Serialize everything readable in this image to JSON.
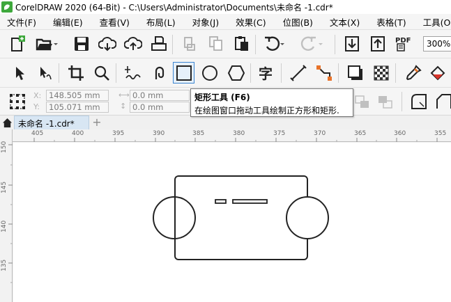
{
  "titlebar": {
    "title": "CorelDRAW 2020 (64-Bit) - C:\\Users\\Administrator\\Documents\\未命名 -1.cdr*"
  },
  "menubar": {
    "items": [
      "文件(F)",
      "编辑(E)",
      "查看(V)",
      "布局(L)",
      "对象(J)",
      "效果(C)",
      "位图(B)",
      "文本(X)",
      "表格(T)",
      "工具(O)"
    ]
  },
  "standard_toolbar": {
    "zoom": "300%",
    "icons": [
      "new-document-icon",
      "open-icon",
      "save-icon",
      "cloud-download-icon",
      "cloud-upload-icon",
      "print-icon",
      "cut-icon",
      "copy-icon",
      "paste-icon",
      "undo-icon",
      "redo-icon",
      "import-icon",
      "export-icon",
      "publish-pdf-icon"
    ]
  },
  "toolbox": {
    "icons": [
      "pick-tool-icon",
      "shape-tool-icon",
      "crop-tool-icon",
      "zoom-tool-icon",
      "freehand-tool-icon",
      "artistic-media-icon",
      "rectangle-tool-icon",
      "ellipse-tool-icon",
      "polygon-tool-icon",
      "text-tool-icon",
      "parallel-dimension-icon",
      "connector-icon",
      "drop-shadow-icon",
      "transparency-icon",
      "eyedropper-icon",
      "interactive-fill-icon"
    ],
    "active": "rectangle-tool-icon"
  },
  "property_bar": {
    "x_label": "X:",
    "y_label": "Y:",
    "x_value": "148.505 mm",
    "y_value": "105.071 mm",
    "w_value": "0.0 mm",
    "h_value": "0.0 mm"
  },
  "tooltip": {
    "title": "矩形工具 (F6)",
    "description": "在绘图窗口拖动工具绘制正方形和矩形."
  },
  "tabs": {
    "document": "未命名 -1.cdr*",
    "add": "+"
  },
  "rulers": {
    "horizontal": [
      "405",
      "400",
      "395",
      "390",
      "385",
      "380",
      "375",
      "370",
      "365",
      "360",
      "355"
    ],
    "vertical": [
      "150",
      "145",
      "140",
      "135"
    ]
  },
  "colors": {
    "active_tool_border": "#3a84d0",
    "tab_bg": "#d8e6f3",
    "logo_green": "#3ea83c"
  }
}
